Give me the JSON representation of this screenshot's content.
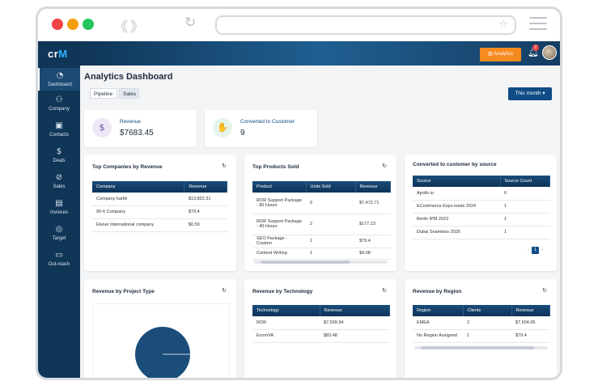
{
  "header": {
    "title": "Analytics Dashboard",
    "analytics_button": "Analytics",
    "notification_count": "2",
    "period_button": "This month"
  },
  "tabs": [
    "Pipeline",
    "Sales"
  ],
  "sidebar": {
    "logo_main": "cr",
    "logo_accent": "M",
    "items": [
      {
        "label": "Dashboard",
        "icon": "gauge-icon"
      },
      {
        "label": "Company",
        "icon": "people-icon"
      },
      {
        "label": "Contacts",
        "icon": "contact-card-icon"
      },
      {
        "label": "Deals",
        "icon": "dollar-icon"
      },
      {
        "label": "Sales",
        "icon": "sales-icon"
      },
      {
        "label": "Invoices",
        "icon": "invoice-icon"
      },
      {
        "label": "Target",
        "icon": "target-icon"
      },
      {
        "label": "Out-reach",
        "icon": "folder-icon"
      }
    ]
  },
  "stats": {
    "revenue_label": "Revenue",
    "revenue_value": "$7683.45",
    "converted_label": "Converted to Customer",
    "converted_value": "9"
  },
  "top_companies": {
    "title": "Top Companies by Revenue",
    "columns": [
      "Company",
      "Revenue"
    ],
    "rows": [
      [
        "Company kartik",
        "$13,822.31"
      ],
      [
        "90-6 Company",
        "$79.4"
      ],
      [
        "Elsner International company",
        "$0.59"
      ]
    ]
  },
  "top_products": {
    "title": "Top Products Sold",
    "columns": [
      "Product",
      "Units Sold",
      "Revenue"
    ],
    "rows": [
      [
        "ROR Support Package - 80 Hours",
        "5",
        "$7,472.71"
      ],
      [
        "ROR Support Package - 40 Hours",
        "2",
        "$177.23"
      ],
      [
        "SEO Package - Custom",
        "1",
        "$79.4"
      ],
      [
        "Content Writing",
        "1",
        "$4.08"
      ]
    ]
  },
  "converted_by_source": {
    "title": "Converted to customer by source",
    "columns": [
      "Source",
      "Source Count"
    ],
    "rows": [
      [
        "Apollo.io",
        "6"
      ],
      [
        "ECommerce Expo leads 2024",
        "1"
      ],
      [
        "Berlin IPM 2023",
        "1"
      ],
      [
        "Dubai Seamless 2025",
        "1"
      ]
    ],
    "pager": {
      "prev": "‹",
      "page": "1",
      "next": "›"
    }
  },
  "revenue_project_type": {
    "title": "Revenue by Project Type"
  },
  "revenue_technology": {
    "title": "Revenue by Technology",
    "columns": [
      "Technology",
      "Revenue"
    ],
    "rows": [
      [
        "ROR",
        "$7,599.94"
      ],
      [
        "EcomVA",
        "$83.48"
      ]
    ]
  },
  "revenue_region": {
    "title": "Revenue by Region",
    "columns": [
      "Region",
      "Clients",
      "Revenue"
    ],
    "rows": [
      [
        "EMEA",
        "2",
        "$7,604.05"
      ],
      [
        "No Region Assigned",
        "1",
        "$79.4"
      ]
    ]
  },
  "colors": {
    "sidebar": "#0f3557",
    "accent_orange": "#f58a1f",
    "table_header": "#0d3257",
    "pie_fill": "#1a4d7a"
  }
}
